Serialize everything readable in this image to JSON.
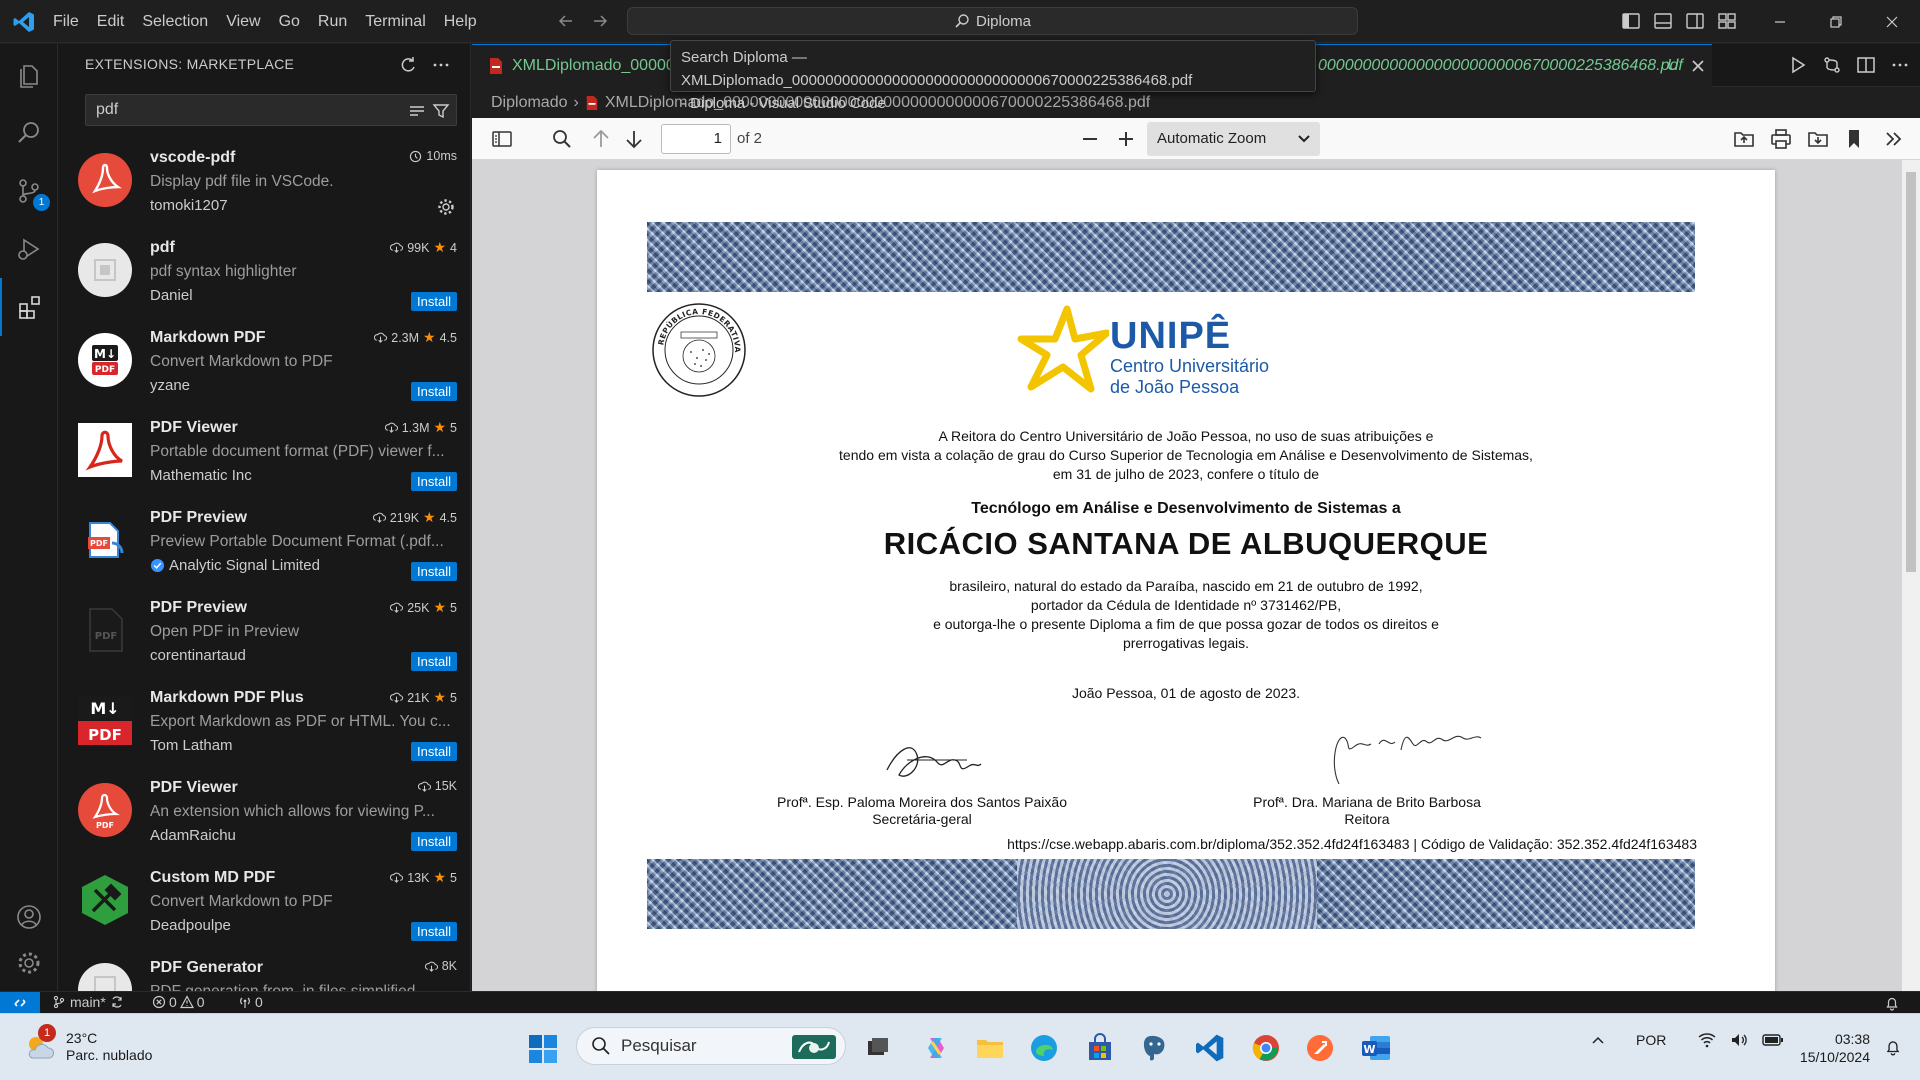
{
  "titlebar": {
    "menus": [
      "File",
      "Edit",
      "Selection",
      "View",
      "Go",
      "Run",
      "Terminal",
      "Help"
    ],
    "command_center": "Diploma",
    "tooltip_line1": "Search Diploma — XMLDiplomado_000000000000000000000000000000670000225386468.pdf",
    "tooltip_line2": "- Diploma - Visual Studio Code"
  },
  "activity_bar": {
    "items": [
      "explorer-icon",
      "search-icon",
      "source-control-icon",
      "run-debug-icon",
      "extensions-icon"
    ],
    "scm_badge": "1",
    "bottom": [
      "accounts-icon",
      "manage-gear-icon"
    ]
  },
  "sidebar": {
    "title": "EXTENSIONS: MARKETPLACE",
    "search_value": "pdf",
    "extensions": [
      {
        "name": "vscode-pdf",
        "desc": "Display pdf file in VSCode.",
        "author": "tomoki1207",
        "stats": "10ms",
        "rating": "",
        "install": "",
        "icon_color": "#e64a3b"
      },
      {
        "name": "pdf",
        "desc": "pdf syntax highlighter",
        "author": "Daniel",
        "stats": "99K",
        "rating": "4",
        "install": "Install",
        "icon_color": "#e8e8e8"
      },
      {
        "name": "Markdown PDF",
        "desc": "Convert Markdown to PDF",
        "author": "yzane",
        "stats": "2.3M",
        "rating": "4.5",
        "install": "Install",
        "icon_color": "#ffffff"
      },
      {
        "name": "PDF Viewer",
        "desc": "Portable document format (PDF) viewer f...",
        "author": "Mathematic Inc",
        "stats": "1.3M",
        "rating": "5",
        "install": "Install",
        "icon_color": "#ffffff"
      },
      {
        "name": "PDF Preview",
        "desc": "Preview Portable Document Format (.pdf...",
        "author": "Analytic Signal Limited",
        "stats": "219K",
        "rating": "4.5",
        "install": "Install",
        "icon_color": "#3a86d6"
      },
      {
        "name": "PDF Preview",
        "desc": "Open PDF in Preview",
        "author": "corentinartaud",
        "stats": "25K",
        "rating": "5",
        "install": "Install",
        "icon_color": "#1a1a1a"
      },
      {
        "name": "Markdown PDF Plus",
        "desc": "Export Markdown as PDF or HTML. You c...",
        "author": "Tom Latham",
        "stats": "21K",
        "rating": "5",
        "install": "Install",
        "icon_color": "#d9262c"
      },
      {
        "name": "PDF Viewer",
        "desc": "An extension which allows for viewing P...",
        "author": "AdamRaichu",
        "stats": "15K",
        "rating": "",
        "install": "Install",
        "icon_color": "#e64a3b"
      },
      {
        "name": "Custom MD PDF",
        "desc": "Convert Markdown to PDF",
        "author": "Deadpoulpe",
        "stats": "13K",
        "rating": "5",
        "install": "Install",
        "icon_color": "#2e9e3e"
      },
      {
        "name": "PDF Generator",
        "desc": "PDF generation from .in files simplified",
        "author": "",
        "stats": "8K",
        "rating": "",
        "install": "",
        "icon_color": "#e8e8e8"
      }
    ]
  },
  "editor": {
    "tab_label_left": "XMLDiplomado_00000",
    "tab_label_right": "00000000000000000000000670000225386468.pdf",
    "tab_status": "U",
    "breadcrumb": [
      "Diplomado",
      "XMLDiplomado_000000000000000000000000000000670000225386468.pdf"
    ]
  },
  "pdf_toolbar": {
    "page_value": "1",
    "page_of": "of 2",
    "zoom": "Automatic Zoom"
  },
  "diploma": {
    "logo_name": "UNIPÊ",
    "logo_sub1": "Centro Universitário",
    "logo_sub2": "de João Pessoa",
    "intro_l1": "A Reitora do Centro Universitário de João Pessoa, no uso de suas atribuições e",
    "intro_l2": "tendo em vista a colação de grau do Curso Superior de Tecnologia em Análise e Desenvolvimento de Sistemas,",
    "intro_l3": "em 31 de julho de 2023, confere o título de",
    "degree": "Tecnólogo em Análise e Desenvolvimento de Sistemas a",
    "graduate": "RICÁCIO SANTANA DE ALBUQUERQUE",
    "details_l1": "brasileiro, natural do estado da Paraíba, nascido em 21 de outubro de 1992,",
    "details_l2": "portador da Cédula de Identidade nº 3731462/PB,",
    "details_l3": "e outorga-lhe o presente Diploma a fim de que possa gozar de todos os direitos e",
    "details_l4": "prerrogativas legais.",
    "place_date": "João Pessoa, 01 de agosto de 2023.",
    "signer1_name": "Profª. Esp. Paloma Moreira dos Santos Paixão",
    "signer1_role": "Secretária-geral",
    "signer2_name": "Profª. Dra. Mariana de Brito Barbosa",
    "signer2_role": "Reitora",
    "validation": "https://cse.webapp.abaris.com.br/diploma/352.352.4fd24f163483 | Código de Validação: 352.352.4fd24f163483",
    "seal_text": "REPÚBLICA FEDERATIVA DO BRASIL"
  },
  "statusbar": {
    "branch": "main*",
    "errors": "0",
    "warnings": "0",
    "ports": "0"
  },
  "taskbar": {
    "weather_badge": "1",
    "temperature": "23°C",
    "condition": "Parc. nublado",
    "search_label": "Pesquisar",
    "lang": "POR",
    "time": "03:38",
    "date": "15/10/2024"
  }
}
